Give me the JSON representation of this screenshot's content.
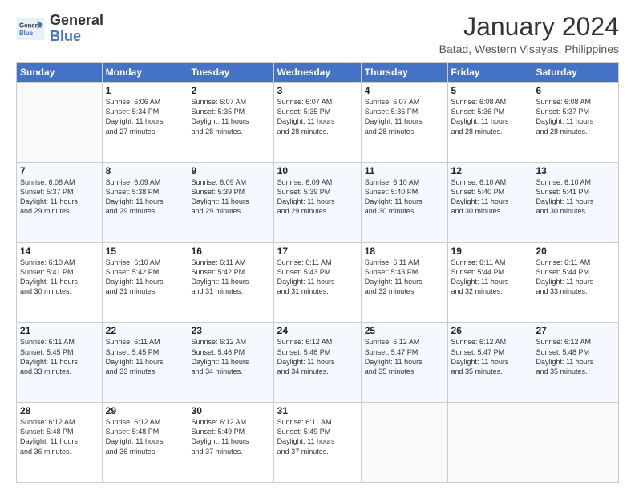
{
  "header": {
    "logo_general": "General",
    "logo_blue": "Blue",
    "main_title": "January 2024",
    "subtitle": "Batad, Western Visayas, Philippines"
  },
  "days_of_week": [
    "Sunday",
    "Monday",
    "Tuesday",
    "Wednesday",
    "Thursday",
    "Friday",
    "Saturday"
  ],
  "weeks": [
    [
      {
        "day": "",
        "info": ""
      },
      {
        "day": "1",
        "info": "Sunrise: 6:06 AM\nSunset: 5:34 PM\nDaylight: 11 hours\nand 27 minutes."
      },
      {
        "day": "2",
        "info": "Sunrise: 6:07 AM\nSunset: 5:35 PM\nDaylight: 11 hours\nand 28 minutes."
      },
      {
        "day": "3",
        "info": "Sunrise: 6:07 AM\nSunset: 5:35 PM\nDaylight: 11 hours\nand 28 minutes."
      },
      {
        "day": "4",
        "info": "Sunrise: 6:07 AM\nSunset: 5:36 PM\nDaylight: 11 hours\nand 28 minutes."
      },
      {
        "day": "5",
        "info": "Sunrise: 6:08 AM\nSunset: 5:36 PM\nDaylight: 11 hours\nand 28 minutes."
      },
      {
        "day": "6",
        "info": "Sunrise: 6:08 AM\nSunset: 5:37 PM\nDaylight: 11 hours\nand 28 minutes."
      }
    ],
    [
      {
        "day": "7",
        "info": "Sunrise: 6:08 AM\nSunset: 5:37 PM\nDaylight: 11 hours\nand 29 minutes."
      },
      {
        "day": "8",
        "info": "Sunrise: 6:09 AM\nSunset: 5:38 PM\nDaylight: 11 hours\nand 29 minutes."
      },
      {
        "day": "9",
        "info": "Sunrise: 6:09 AM\nSunset: 5:39 PM\nDaylight: 11 hours\nand 29 minutes."
      },
      {
        "day": "10",
        "info": "Sunrise: 6:09 AM\nSunset: 5:39 PM\nDaylight: 11 hours\nand 29 minutes."
      },
      {
        "day": "11",
        "info": "Sunrise: 6:10 AM\nSunset: 5:40 PM\nDaylight: 11 hours\nand 30 minutes."
      },
      {
        "day": "12",
        "info": "Sunrise: 6:10 AM\nSunset: 5:40 PM\nDaylight: 11 hours\nand 30 minutes."
      },
      {
        "day": "13",
        "info": "Sunrise: 6:10 AM\nSunset: 5:41 PM\nDaylight: 11 hours\nand 30 minutes."
      }
    ],
    [
      {
        "day": "14",
        "info": "Sunrise: 6:10 AM\nSunset: 5:41 PM\nDaylight: 11 hours\nand 30 minutes."
      },
      {
        "day": "15",
        "info": "Sunrise: 6:10 AM\nSunset: 5:42 PM\nDaylight: 11 hours\nand 31 minutes."
      },
      {
        "day": "16",
        "info": "Sunrise: 6:11 AM\nSunset: 5:42 PM\nDaylight: 11 hours\nand 31 minutes."
      },
      {
        "day": "17",
        "info": "Sunrise: 6:11 AM\nSunset: 5:43 PM\nDaylight: 11 hours\nand 31 minutes."
      },
      {
        "day": "18",
        "info": "Sunrise: 6:11 AM\nSunset: 5:43 PM\nDaylight: 11 hours\nand 32 minutes."
      },
      {
        "day": "19",
        "info": "Sunrise: 6:11 AM\nSunset: 5:44 PM\nDaylight: 11 hours\nand 32 minutes."
      },
      {
        "day": "20",
        "info": "Sunrise: 6:11 AM\nSunset: 5:44 PM\nDaylight: 11 hours\nand 33 minutes."
      }
    ],
    [
      {
        "day": "21",
        "info": "Sunrise: 6:11 AM\nSunset: 5:45 PM\nDaylight: 11 hours\nand 33 minutes."
      },
      {
        "day": "22",
        "info": "Sunrise: 6:11 AM\nSunset: 5:45 PM\nDaylight: 11 hours\nand 33 minutes."
      },
      {
        "day": "23",
        "info": "Sunrise: 6:12 AM\nSunset: 5:46 PM\nDaylight: 11 hours\nand 34 minutes."
      },
      {
        "day": "24",
        "info": "Sunrise: 6:12 AM\nSunset: 5:46 PM\nDaylight: 11 hours\nand 34 minutes."
      },
      {
        "day": "25",
        "info": "Sunrise: 6:12 AM\nSunset: 5:47 PM\nDaylight: 11 hours\nand 35 minutes."
      },
      {
        "day": "26",
        "info": "Sunrise: 6:12 AM\nSunset: 5:47 PM\nDaylight: 11 hours\nand 35 minutes."
      },
      {
        "day": "27",
        "info": "Sunrise: 6:12 AM\nSunset: 5:48 PM\nDaylight: 11 hours\nand 35 minutes."
      }
    ],
    [
      {
        "day": "28",
        "info": "Sunrise: 6:12 AM\nSunset: 5:48 PM\nDaylight: 11 hours\nand 36 minutes."
      },
      {
        "day": "29",
        "info": "Sunrise: 6:12 AM\nSunset: 5:48 PM\nDaylight: 11 hours\nand 36 minutes."
      },
      {
        "day": "30",
        "info": "Sunrise: 6:12 AM\nSunset: 5:49 PM\nDaylight: 11 hours\nand 37 minutes."
      },
      {
        "day": "31",
        "info": "Sunrise: 6:11 AM\nSunset: 5:49 PM\nDaylight: 11 hours\nand 37 minutes."
      },
      {
        "day": "",
        "info": ""
      },
      {
        "day": "",
        "info": ""
      },
      {
        "day": "",
        "info": ""
      }
    ]
  ]
}
